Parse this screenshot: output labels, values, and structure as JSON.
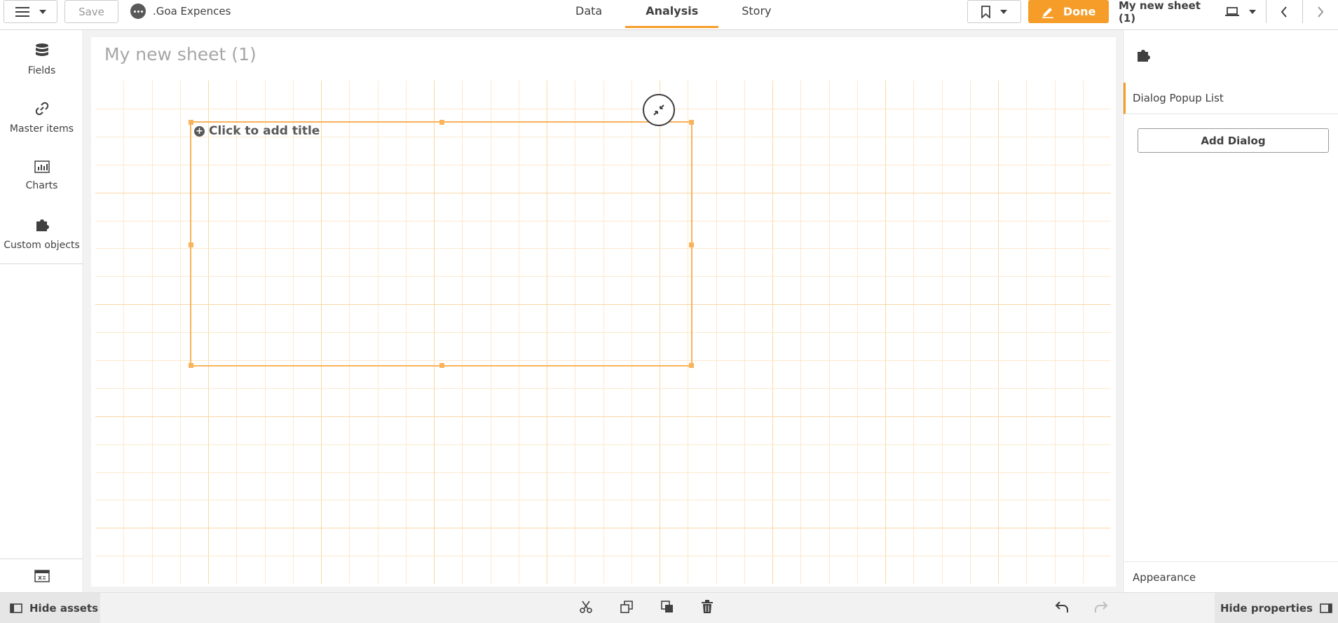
{
  "topbar": {
    "save_label": "Save",
    "app_name": ".Goa Expences",
    "tabs": [
      {
        "label": "Data",
        "active": false
      },
      {
        "label": "Analysis",
        "active": true
      },
      {
        "label": "Story",
        "active": false
      }
    ],
    "done_label": "Done",
    "sheet_name": "My new sheet (1)"
  },
  "assets": {
    "items": [
      {
        "label": "Fields",
        "icon": "database-icon"
      },
      {
        "label": "Master items",
        "icon": "link-icon"
      },
      {
        "label": "Charts",
        "icon": "bar-chart-icon"
      },
      {
        "label": "Custom objects",
        "icon": "puzzle-icon"
      }
    ]
  },
  "canvas": {
    "sheet_title": "My new sheet (1)",
    "object_title": "Click to add title"
  },
  "properties": {
    "section_label": "Dialog Popup List",
    "add_button_label": "Add Dialog",
    "appearance_label": "Appearance"
  },
  "bottombar": {
    "hide_assets_label": "Hide assets",
    "hide_properties_label": "Hide properties"
  },
  "colors": {
    "accent": "#f59d28",
    "selection": "#f9b35a",
    "grid": "#fde8cd"
  }
}
